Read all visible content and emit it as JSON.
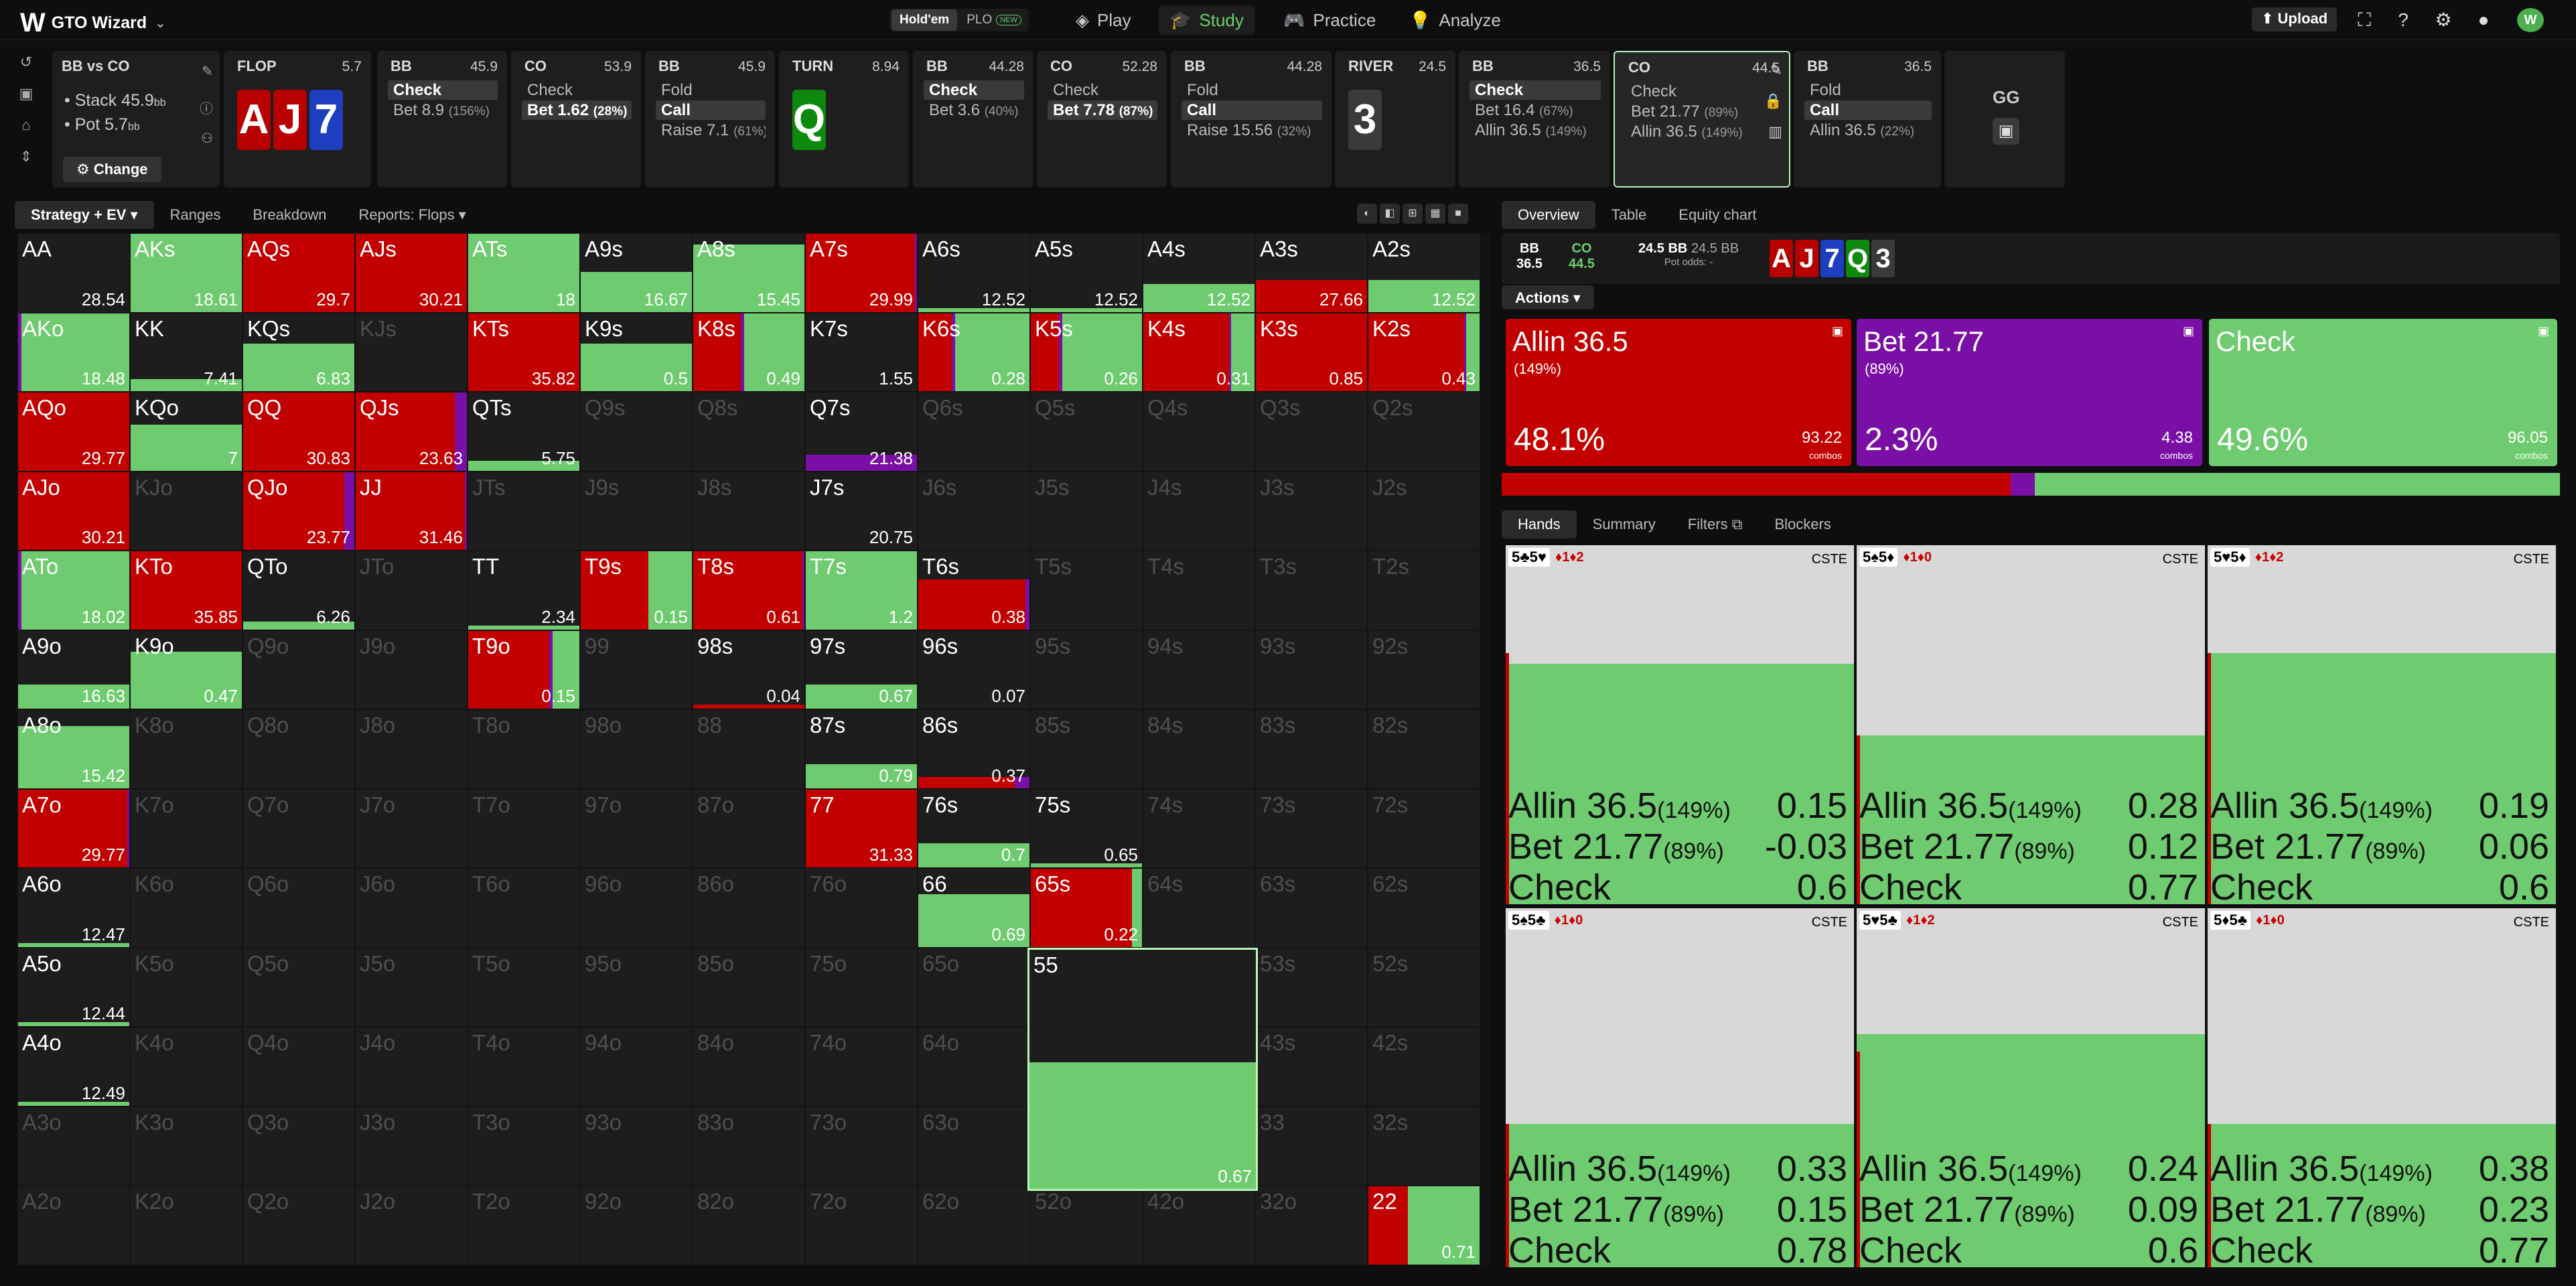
{
  "nav": {
    "app_name": "GTO Wizard",
    "modes": [
      "Hold'em",
      "PLO"
    ],
    "new_badge": "NEW",
    "items": [
      "Play",
      "Study",
      "Practice",
      "Analyze"
    ],
    "upload": "Upload",
    "avatar": "W"
  },
  "info": {
    "matchup": "BB vs CO",
    "stack": "Stack 45.9",
    "pot": "Pot 5.7",
    "unit": "bb",
    "change": "Change"
  },
  "action_cards": [
    {
      "kind": "board",
      "pos": "FLOP",
      "stack": "5.7",
      "cards": [
        {
          "r": "A",
          "c": "r"
        },
        {
          "r": "J",
          "c": "r"
        },
        {
          "r": "7",
          "c": "b"
        }
      ]
    },
    {
      "kind": "player",
      "pos": "BB",
      "stack": "45.9",
      "actions": [
        {
          "l": "Check",
          "p": "",
          "sel": true
        },
        {
          "l": "Bet 8.9",
          "p": "(156%)",
          "sel": false
        }
      ]
    },
    {
      "kind": "player",
      "pos": "CO",
      "stack": "53.9",
      "actions": [
        {
          "l": "Check",
          "p": "",
          "sel": false
        },
        {
          "l": "Bet 1.62",
          "p": "(28%)",
          "sel": true
        }
      ]
    },
    {
      "kind": "player",
      "pos": "BB",
      "stack": "45.9",
      "actions": [
        {
          "l": "Fold",
          "p": "",
          "sel": false
        },
        {
          "l": "Call",
          "p": "",
          "sel": true
        },
        {
          "l": "Raise 7.1",
          "p": "(61%)",
          "sel": false
        }
      ]
    },
    {
      "kind": "board",
      "pos": "TURN",
      "stack": "8.94",
      "cards": [
        {
          "r": "Q",
          "c": "g"
        }
      ]
    },
    {
      "kind": "player",
      "pos": "BB",
      "stack": "44.28",
      "actions": [
        {
          "l": "Check",
          "p": "",
          "sel": true
        },
        {
          "l": "Bet 3.6",
          "p": "(40%)",
          "sel": false
        }
      ]
    },
    {
      "kind": "player",
      "pos": "CO",
      "stack": "52.28",
      "actions": [
        {
          "l": "Check",
          "p": "",
          "sel": false
        },
        {
          "l": "Bet 7.78",
          "p": "(87%)",
          "sel": true
        }
      ]
    },
    {
      "kind": "player",
      "pos": "BB",
      "stack": "44.28",
      "actions": [
        {
          "l": "Fold",
          "p": "",
          "sel": false
        },
        {
          "l": "Call",
          "p": "",
          "sel": true
        },
        {
          "l": "Raise 15.56",
          "p": "(32%)",
          "sel": false
        }
      ]
    },
    {
      "kind": "board",
      "pos": "RIVER",
      "stack": "24.5",
      "cards": [
        {
          "r": "3",
          "c": "k"
        }
      ]
    },
    {
      "kind": "player",
      "pos": "BB",
      "stack": "36.5",
      "actions": [
        {
          "l": "Check",
          "p": "",
          "sel": true
        },
        {
          "l": "Bet 16.4",
          "p": "(67%)",
          "sel": false
        },
        {
          "l": "Allin 36.5",
          "p": "(149%)",
          "sel": false
        }
      ]
    },
    {
      "kind": "player",
      "pos": "CO",
      "stack": "44.5",
      "selected": true,
      "actions": [
        {
          "l": "Check",
          "p": "",
          "sel": false
        },
        {
          "l": "Bet 21.77",
          "p": "(89%)",
          "sel": false
        },
        {
          "l": "Allin 36.5",
          "p": "(149%)",
          "sel": false
        }
      ]
    },
    {
      "kind": "player",
      "pos": "BB",
      "stack": "36.5",
      "actions": [
        {
          "l": "Fold",
          "p": "",
          "sel": false
        },
        {
          "l": "Call",
          "p": "",
          "sel": true
        },
        {
          "l": "Allin 36.5",
          "p": "(22%)",
          "sel": false
        }
      ]
    }
  ],
  "gg": "GG",
  "left_tabs": [
    "Strategy + EV",
    "Ranges",
    "Breakdown",
    "Reports: Flops"
  ],
  "ranks": [
    "A",
    "K",
    "Q",
    "J",
    "T",
    "9",
    "8",
    "7",
    "6",
    "5",
    "4",
    "3",
    "2"
  ],
  "matrix": {
    "AA": {
      "ev": "28.54",
      "mix": [
        0,
        0,
        0
      ]
    },
    "AKs": {
      "ev": "18.61",
      "mix": [
        0,
        0,
        1
      ]
    },
    "AQs": {
      "ev": "29.7",
      "mix": [
        1,
        0,
        0
      ]
    },
    "AJs": {
      "ev": "30.21",
      "mix": [
        1,
        0,
        0
      ]
    },
    "ATs": {
      "ev": "18",
      "mix": [
        0,
        0,
        1
      ]
    },
    "A9s": {
      "ev": "16.67",
      "mix": [
        0,
        0,
        0.5
      ]
    },
    "A8s": {
      "ev": "15.45",
      "mix": [
        0,
        0,
        0.85
      ]
    },
    "A7s": {
      "ev": "29.99",
      "mix": [
        0.97,
        0.03,
        0
      ]
    },
    "A6s": {
      "ev": "12.52",
      "mix": [
        0,
        0,
        0.05
      ]
    },
    "A5s": {
      "ev": "12.52",
      "mix": [
        0,
        0,
        0.05
      ]
    },
    "A4s": {
      "ev": "12.52",
      "mix": [
        0,
        0,
        0.35
      ]
    },
    "A3s": {
      "ev": "27.66",
      "mix": [
        0.4,
        0,
        0
      ]
    },
    "A2s": {
      "ev": "12.52",
      "mix": [
        0,
        0,
        0.4
      ]
    },
    "AKo": {
      "ev": "18.48",
      "mix": [
        0,
        0.03,
        0.97
      ]
    },
    "KK": {
      "ev": "7.41",
      "mix": [
        0,
        0,
        0.15
      ]
    },
    "KQs": {
      "ev": "6.83",
      "mix": [
        0,
        0,
        0.6
      ]
    },
    "KTs": {
      "ev": "35.82",
      "mix": [
        1,
        0,
        0
      ]
    },
    "K9s": {
      "ev": "0.5",
      "mix": [
        0,
        0,
        0.6
      ]
    },
    "K8s": {
      "ev": "0.49",
      "mix": [
        0.42,
        0.03,
        0.55
      ]
    },
    "K7s": {
      "ev": "1.55",
      "mix": [
        0,
        0,
        0
      ]
    },
    "K6s": {
      "ev": "0.28",
      "mix": [
        0.3,
        0.03,
        0.67
      ]
    },
    "K5s": {
      "ev": "0.26",
      "mix": [
        0.25,
        0.03,
        0.72
      ]
    },
    "K4s": {
      "ev": "0.31",
      "mix": [
        0.76,
        0.02,
        0.22
      ]
    },
    "K3s": {
      "ev": "0.85",
      "mix": [
        1,
        0,
        0
      ]
    },
    "K2s": {
      "ev": "0.43",
      "mix": [
        0.85,
        0.02,
        0.13
      ]
    },
    "AQo": {
      "ev": "29.77",
      "mix": [
        1,
        0,
        0
      ]
    },
    "KQo": {
      "ev": "7",
      "mix": [
        0,
        0,
        0.58
      ]
    },
    "QQ": {
      "ev": "30.83",
      "mix": [
        1,
        0,
        0
      ]
    },
    "QJs": {
      "ev": "23.63",
      "mix": [
        0.88,
        0.12,
        0
      ]
    },
    "QTs": {
      "ev": "5.75",
      "mix": [
        0,
        0,
        0.12
      ]
    },
    "Q7s": {
      "ev": "21.38",
      "mix": [
        0,
        0.2,
        0
      ]
    },
    "AJo": {
      "ev": "30.21",
      "mix": [
        1,
        0,
        0
      ]
    },
    "QJo": {
      "ev": "23.77",
      "mix": [
        0.9,
        0.1,
        0
      ]
    },
    "JJ": {
      "ev": "31.46",
      "mix": [
        0.97,
        0.03,
        0
      ]
    },
    "J7s": {
      "ev": "20.75",
      "mix": [
        0,
        0,
        0
      ]
    },
    "ATo": {
      "ev": "18.02",
      "mix": [
        0,
        0.03,
        0.97
      ]
    },
    "KTo": {
      "ev": "35.85",
      "mix": [
        1,
        0,
        0
      ]
    },
    "QTo": {
      "ev": "6.26",
      "mix": [
        0,
        0,
        0.1
      ]
    },
    "TT": {
      "ev": "2.34",
      "mix": [
        0,
        0,
        0.03
      ]
    },
    "T9s": {
      "ev": "0.15",
      "mix": [
        0.6,
        0,
        0.4
      ]
    },
    "T8s": {
      "ev": "0.61",
      "mix": [
        0.97,
        0.03,
        0
      ]
    },
    "T7s": {
      "ev": "1.2",
      "mix": [
        0,
        0,
        1
      ]
    },
    "T6s": {
      "ev": "0.38",
      "mix": [
        0.6,
        0.03,
        0
      ]
    },
    "A9o": {
      "ev": "16.63",
      "mix": [
        0,
        0,
        0.3
      ]
    },
    "K9o": {
      "ev": "0.47",
      "mix": [
        0,
        0,
        0.72
      ]
    },
    "T9o": {
      "ev": "0.15",
      "mix": [
        0.72,
        0.03,
        0.25
      ]
    },
    "98s": {
      "ev": "0.04",
      "mix": [
        0.04,
        0,
        0
      ]
    },
    "97s": {
      "ev": "0.67",
      "mix": [
        0,
        0,
        0.3
      ]
    },
    "96s": {
      "ev": "0.07",
      "mix": [
        0,
        0,
        0
      ]
    },
    "A8o": {
      "ev": "15.42",
      "mix": [
        0,
        0,
        0.78
      ]
    },
    "87s": {
      "ev": "0.79",
      "mix": [
        0,
        0,
        0.3
      ]
    },
    "86s": {
      "ev": "0.37",
      "mix": [
        0.12,
        0.02,
        0
      ]
    },
    "A7o": {
      "ev": "29.77",
      "mix": [
        0.97,
        0.03,
        0
      ]
    },
    "77": {
      "ev": "31.33",
      "mix": [
        1,
        0,
        0
      ]
    },
    "76s": {
      "ev": "0.7",
      "mix": [
        0,
        0,
        0.3
      ]
    },
    "75s": {
      "ev": "0.65",
      "mix": [
        0,
        0,
        0.05
      ]
    },
    "A6o": {
      "ev": "12.47",
      "mix": [
        0,
        0,
        0.05
      ]
    },
    "66": {
      "ev": "0.69",
      "mix": [
        0,
        0,
        0.66
      ]
    },
    "65s": {
      "ev": "0.22",
      "mix": [
        0.9,
        0,
        0.1
      ]
    },
    "A5o": {
      "ev": "12.44",
      "mix": [
        0,
        0,
        0.05
      ]
    },
    "55": {
      "ev": "0.67",
      "mix": [
        0,
        0,
        0.53
      ]
    },
    "A4o": {
      "ev": "12.49",
      "mix": [
        0,
        0,
        0.05
      ]
    },
    "22": {
      "ev": "0.71",
      "mix": [
        0.35,
        0,
        0.65
      ]
    }
  },
  "right_tabs": [
    "Overview",
    "Table",
    "Equity chart"
  ],
  "spot": {
    "bb_label": "BB",
    "bb_val": "36.5",
    "co_label": "CO",
    "co_val": "44.5",
    "pot": "24.5 BB",
    "pot2": "24.5 BB",
    "odds_label": "Pot odds:",
    "odds_val": "-"
  },
  "board": [
    {
      "r": "A",
      "c": "r"
    },
    {
      "r": "J",
      "c": "r"
    },
    {
      "r": "7",
      "c": "b"
    },
    {
      "r": "Q",
      "c": "g"
    },
    {
      "r": "3",
      "c": "k"
    }
  ],
  "actions_label": "Actions",
  "action_summary": [
    {
      "name": "Allin 36.5",
      "sub": "(149%)",
      "freq": "48.1%",
      "combos": "93.22",
      "combos_label": "combos",
      "color": "#c20000"
    },
    {
      "name": "Bet 21.77",
      "sub": "(89%)",
      "freq": "2.3%",
      "combos": "4.38",
      "combos_label": "combos",
      "color": "#7a0fa6"
    },
    {
      "name": "Check",
      "sub": "",
      "freq": "49.6%",
      "combos": "96.05",
      "combos_label": "combos",
      "color": "#6fcb6f"
    }
  ],
  "hand_tabs": [
    "Hands",
    "Summary",
    "Filters",
    "Blockers"
  ],
  "hands": [
    {
      "combo": "5♣5♥",
      "blk": "♦1♦2",
      "tag": "CSTE",
      "allin": "0.15",
      "bet": "-0.03",
      "check": "0.6",
      "fill": 0.67,
      "red": 0.7
    },
    {
      "combo": "5♠5♦",
      "blk": "♦1♦0",
      "tag": "CSTE",
      "allin": "0.28",
      "bet": "0.12",
      "check": "0.77",
      "fill": 0.47,
      "red": 0.47
    },
    {
      "combo": "5♥5♦",
      "blk": "♦1♦2",
      "tag": "CSTE",
      "allin": "0.19",
      "bet": "0.06",
      "check": "0.6",
      "fill": 0.7,
      "red": 0.7
    },
    {
      "combo": "5♠5♣",
      "blk": "♦1♦0",
      "tag": "CSTE",
      "allin": "0.33",
      "bet": "0.15",
      "check": "0.78",
      "fill": 0.4,
      "red": 0.4
    },
    {
      "combo": "5♥5♣",
      "blk": "♦1♦2",
      "tag": "CSTE",
      "allin": "0.24",
      "bet": "0.09",
      "check": "0.6",
      "fill": 0.65,
      "red": 0.6
    },
    {
      "combo": "5♦5♣",
      "blk": "♦1♦0",
      "tag": "CSTE",
      "allin": "0.38",
      "bet": "0.23",
      "check": "0.77",
      "fill": 0.4,
      "red": 0.4
    }
  ],
  "labels": {
    "allin": "Allin 36.5",
    "allin_p": "(149%)",
    "bet": "Bet 21.77",
    "bet_p": "(89%)",
    "check": "Check"
  },
  "colors": {
    "allin": "#c20000",
    "bet": "#7a0fa6",
    "check": "#6fcb6f"
  }
}
